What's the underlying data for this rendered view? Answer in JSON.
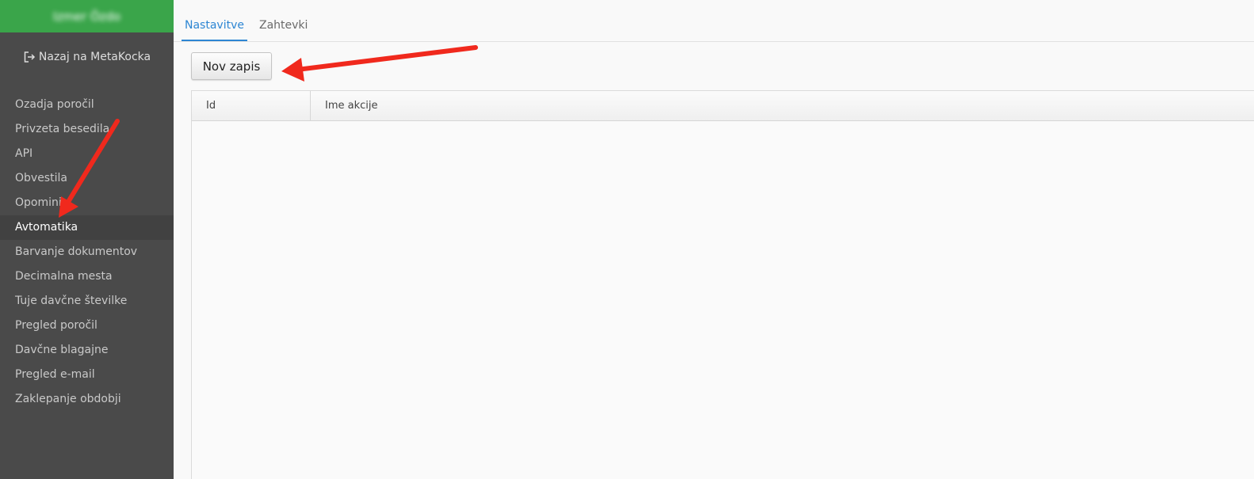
{
  "sidebar": {
    "company_name": "Izmer Özdo",
    "back_link_label": "Nazaj na MetaKocka",
    "items": [
      {
        "label": "Ozadja poročil"
      },
      {
        "label": "Privzeta besedila"
      },
      {
        "label": "API"
      },
      {
        "label": "Obvestila"
      },
      {
        "label": "Opomini"
      },
      {
        "label": "Avtomatika",
        "active": true
      },
      {
        "label": "Barvanje dokumentov"
      },
      {
        "label": "Decimalna mesta"
      },
      {
        "label": "Tuje davčne številke"
      },
      {
        "label": "Pregled poročil"
      },
      {
        "label": "Davčne blagajne"
      },
      {
        "label": "Pregled e-mail"
      },
      {
        "label": "Zaklepanje obdobji"
      }
    ]
  },
  "tabs": [
    {
      "label": "Nastavitve",
      "active": true
    },
    {
      "label": "Zahtevki"
    }
  ],
  "toolbar": {
    "new_record_label": "Nov zapis"
  },
  "grid": {
    "columns": [
      {
        "label": "Id"
      },
      {
        "label": "Ime akcije"
      }
    ],
    "rows": []
  },
  "colors": {
    "sidebar_bg": "#4a4a4a",
    "header_green": "#3aa54a",
    "tab_active": "#2d86d3",
    "annotation_arrow": "#f0291d"
  },
  "icons": {
    "back_link_icon": "sign-out-icon"
  }
}
